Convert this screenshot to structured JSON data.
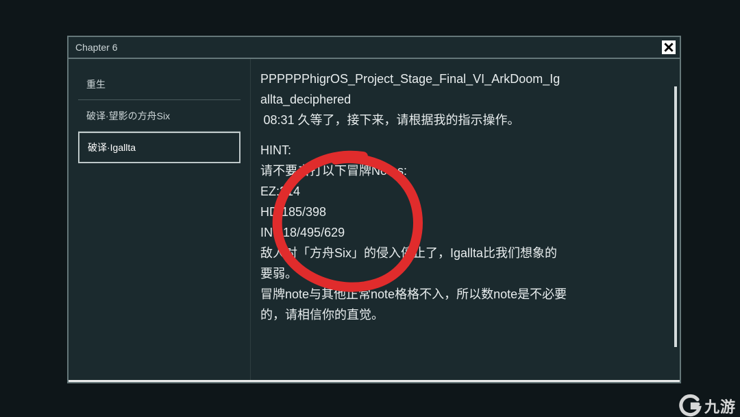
{
  "window": {
    "title": "Chapter 6"
  },
  "sidebar": {
    "items": [
      {
        "label": "重生",
        "active": false
      },
      {
        "label": "破译·望影の方舟Six",
        "active": false
      },
      {
        "label": "破译·Igallta",
        "active": true
      }
    ]
  },
  "content": {
    "heading_line1": "PPPPPPhigrOS_Project_Stage_Final_VI_ArkDoom_Ig",
    "heading_line2": "allta_deciphered",
    "timestamp_line": " 08:31 久等了，接下来，请根据我的指示操作。",
    "hint_label": "HINT:",
    "hint_line1": "请不要击打以下冒牌Notes:",
    "ez_line": "EZ:214",
    "hd_line": "HD:185/398",
    "in_line": "IN:218/495/629",
    "story_line1": "敌人对「方舟Six」的侵入停止了，Igallta比我们想象的",
    "story_line2": "要弱。",
    "story_line3": "冒牌note与其他正常note格格不入，所以数note是不必要",
    "story_line4": "的，请相信你的直觉。"
  },
  "annotation": {
    "color": "#e02c2c"
  },
  "watermark": {
    "text": "九游"
  }
}
